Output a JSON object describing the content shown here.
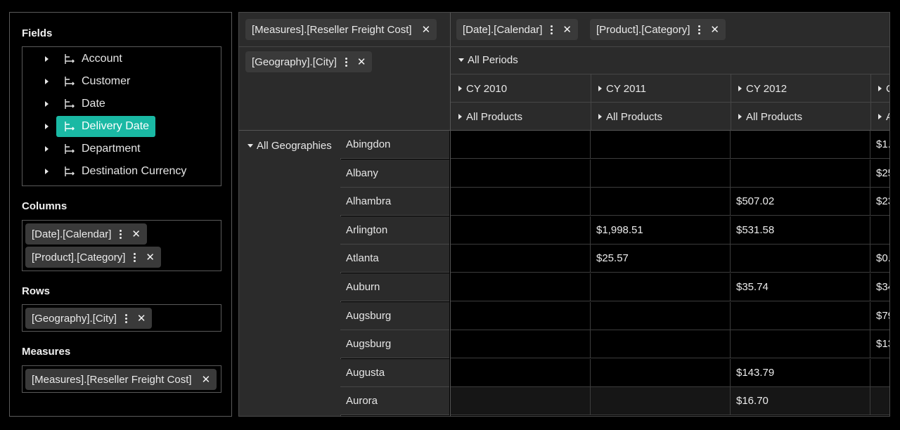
{
  "selector": {
    "fields_title": "Fields",
    "fields": [
      "Account",
      "Customer",
      "Date",
      "Delivery Date",
      "Department",
      "Destination Currency"
    ],
    "selected_field": "Delivery Date",
    "columns_title": "Columns",
    "columns": [
      "[Date].[Calendar]",
      "[Product].[Category]"
    ],
    "rows_title": "Rows",
    "rows": [
      "[Geography].[City]"
    ],
    "measures_title": "Measures",
    "measures": [
      "[Measures].[Reseller Freight Cost]"
    ],
    "accent_color": "#1ab9a4"
  },
  "grid": {
    "header_chips": {
      "measure": "[Measures].[Reseller Freight Cost]",
      "col1": "[Date].[Calendar]",
      "col2": "[Product].[Category]",
      "row1": "[Geography].[City]"
    },
    "all_periods": "All Periods",
    "years": [
      "CY 2010",
      "CY 2011",
      "CY 2012",
      "C"
    ],
    "products": [
      "All Products",
      "All Products",
      "All Products",
      "A"
    ],
    "all_geographies": "All Geographies",
    "rows": [
      {
        "city": "Abingdon",
        "v": [
          "",
          "",
          "",
          "$1."
        ]
      },
      {
        "city": "Albany",
        "v": [
          "",
          "",
          "",
          "$25"
        ]
      },
      {
        "city": "Alhambra",
        "v": [
          "",
          "",
          "$507.02",
          "$23"
        ]
      },
      {
        "city": "Arlington",
        "v": [
          "",
          "$1,998.51",
          "$531.58",
          ""
        ]
      },
      {
        "city": "Atlanta",
        "v": [
          "",
          "$25.57",
          "",
          "$0."
        ]
      },
      {
        "city": "Auburn",
        "v": [
          "",
          "",
          "$35.74",
          "$34"
        ]
      },
      {
        "city": "Augsburg",
        "v": [
          "",
          "",
          "",
          "$79"
        ]
      },
      {
        "city": "Augsburg",
        "v": [
          "",
          "",
          "",
          "$13"
        ]
      },
      {
        "city": "Augusta",
        "v": [
          "",
          "",
          "$143.79",
          ""
        ]
      },
      {
        "city": "Aurora",
        "v": [
          "",
          "",
          "$16.70",
          ""
        ]
      }
    ]
  }
}
